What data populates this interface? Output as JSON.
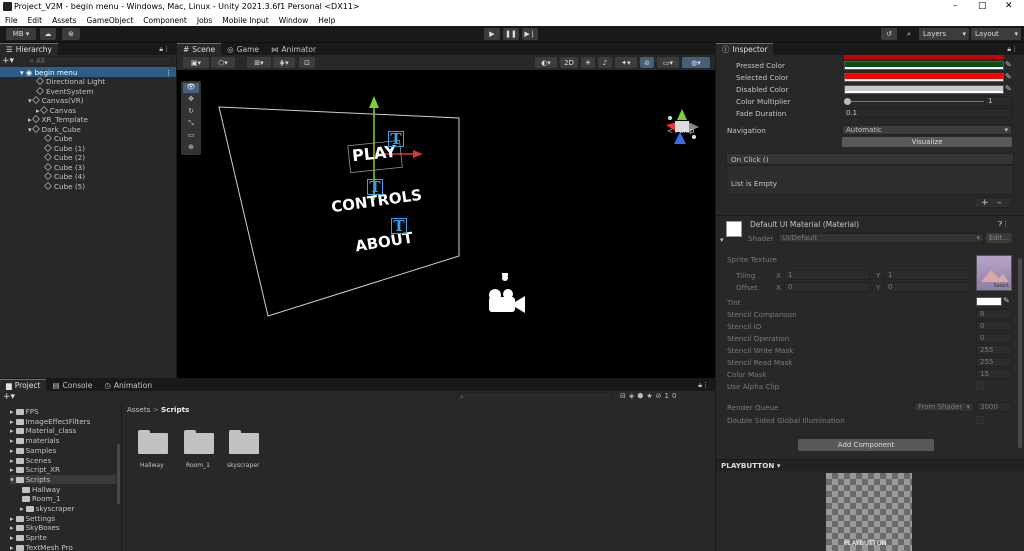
{
  "window": {
    "title": "Project_V2M - begin menu - Windows, Mac, Linux - Unity 2021.3.6f1 Personal <DX11>",
    "minimize": "–",
    "maximize": "□",
    "close": "✕"
  },
  "menu": [
    "File",
    "Edit",
    "Assets",
    "GameObject",
    "Component",
    "Jobs",
    "Mobile Input",
    "Window",
    "Help"
  ],
  "toolbar": {
    "account": "MB ▾",
    "layers": "Layers",
    "layout": "Layout"
  },
  "hierarchy": {
    "tab": "Hierarchy",
    "search_placeholder": "All",
    "scene": "begin menu",
    "items": [
      {
        "label": "Directional Light"
      },
      {
        "label": "EventSystem"
      },
      {
        "label": "Canvas(VR)"
      },
      {
        "label": "Canvas"
      },
      {
        "label": "XR_Template"
      },
      {
        "label": "Dark_Cube"
      },
      {
        "label": "Cube"
      },
      {
        "label": "Cube (1)"
      },
      {
        "label": "Cube (2)"
      },
      {
        "label": "Cube (3)"
      },
      {
        "label": "Cube (4)"
      },
      {
        "label": "Cube (5)"
      }
    ]
  },
  "scene_tabs": [
    "Scene",
    "Game",
    "Animator"
  ],
  "scene": {
    "mode_2d": "2D",
    "persp": "Persp",
    "labels": [
      "PLAY",
      "CONTROLS",
      "ABOUT"
    ]
  },
  "project": {
    "tabs": [
      "Project",
      "Console",
      "Animation"
    ],
    "badge": "10",
    "breadcrumb_root": "Assets",
    "breadcrumb_sep": ">",
    "breadcrumb_current": "Scripts",
    "tree": [
      {
        "label": "FPS",
        "indent": 1
      },
      {
        "label": "ImageEffectFilters",
        "indent": 1
      },
      {
        "label": "Material_class",
        "indent": 1
      },
      {
        "label": "materials",
        "indent": 1
      },
      {
        "label": "Samples",
        "indent": 1
      },
      {
        "label": "Scenes",
        "indent": 1
      },
      {
        "label": "Script_XR",
        "indent": 1
      },
      {
        "label": "Scripts",
        "indent": 1
      },
      {
        "label": "Hallway",
        "indent": 2
      },
      {
        "label": "Room_1",
        "indent": 2
      },
      {
        "label": "skyscraper",
        "indent": 2
      },
      {
        "label": "Settings",
        "indent": 1
      },
      {
        "label": "SkyBoxes",
        "indent": 1
      },
      {
        "label": "Sprite",
        "indent": 1
      },
      {
        "label": "TextMesh Pro",
        "indent": 1
      }
    ],
    "folders": [
      "Hallway",
      "Room_1",
      "skyscraper"
    ]
  },
  "inspector": {
    "tab": "Inspector",
    "color_rows": [
      {
        "label": "Pressed Color",
        "color": "#0b4f12"
      },
      {
        "label": "Selected Color",
        "color": "#ff0000"
      },
      {
        "label": "Disabled Color",
        "color": "#c8c8c8"
      }
    ],
    "color_multiplier_label": "Color Multiplier",
    "color_multiplier_value": "1",
    "fade_duration_label": "Fade Duration",
    "fade_duration_value": "0.1",
    "navigation_label": "Navigation",
    "navigation_value": "Automatic",
    "visualize": "Visualize",
    "on_click": "On Click ()",
    "list_empty": "List is Empty",
    "plus": "+",
    "minus": "–",
    "material_name": "Default UI Material (Material)",
    "shader_label": "Shader",
    "shader_value": "UI/Default",
    "edit": "Edit...",
    "sprite_texture": "Sprite Texture",
    "tiling": "Tiling",
    "offset": "Offset",
    "tiling_x": "1",
    "tiling_y": "1",
    "offset_x": "0",
    "offset_y": "0",
    "x_label": "X",
    "y_label": "Y",
    "select": "Select",
    "tint": "Tint",
    "props": [
      {
        "label": "Stencil Comparison",
        "value": "8"
      },
      {
        "label": "Stencil ID",
        "value": "0"
      },
      {
        "label": "Stencil Operation",
        "value": "0"
      },
      {
        "label": "Stencil Write Mask",
        "value": "255"
      },
      {
        "label": "Stencil Read Mask",
        "value": "255"
      },
      {
        "label": "Color Mask",
        "value": "15"
      },
      {
        "label": "Use Alpha Clip",
        "value": ""
      }
    ],
    "render_queue_label": "Render Queue",
    "render_queue_mode": "From Shader",
    "render_queue_value": "3000",
    "double_sided": "Double Sided Global Illumination",
    "add_component": "Add Component",
    "preview_title": "PLAYBUTTON",
    "preview_caption": "PLAYBUTTON"
  },
  "colors": {
    "accent": "#3a79bb",
    "pressed": "#0b4f12",
    "selected": "#ff0000",
    "disabled": "#c8c8c8"
  }
}
